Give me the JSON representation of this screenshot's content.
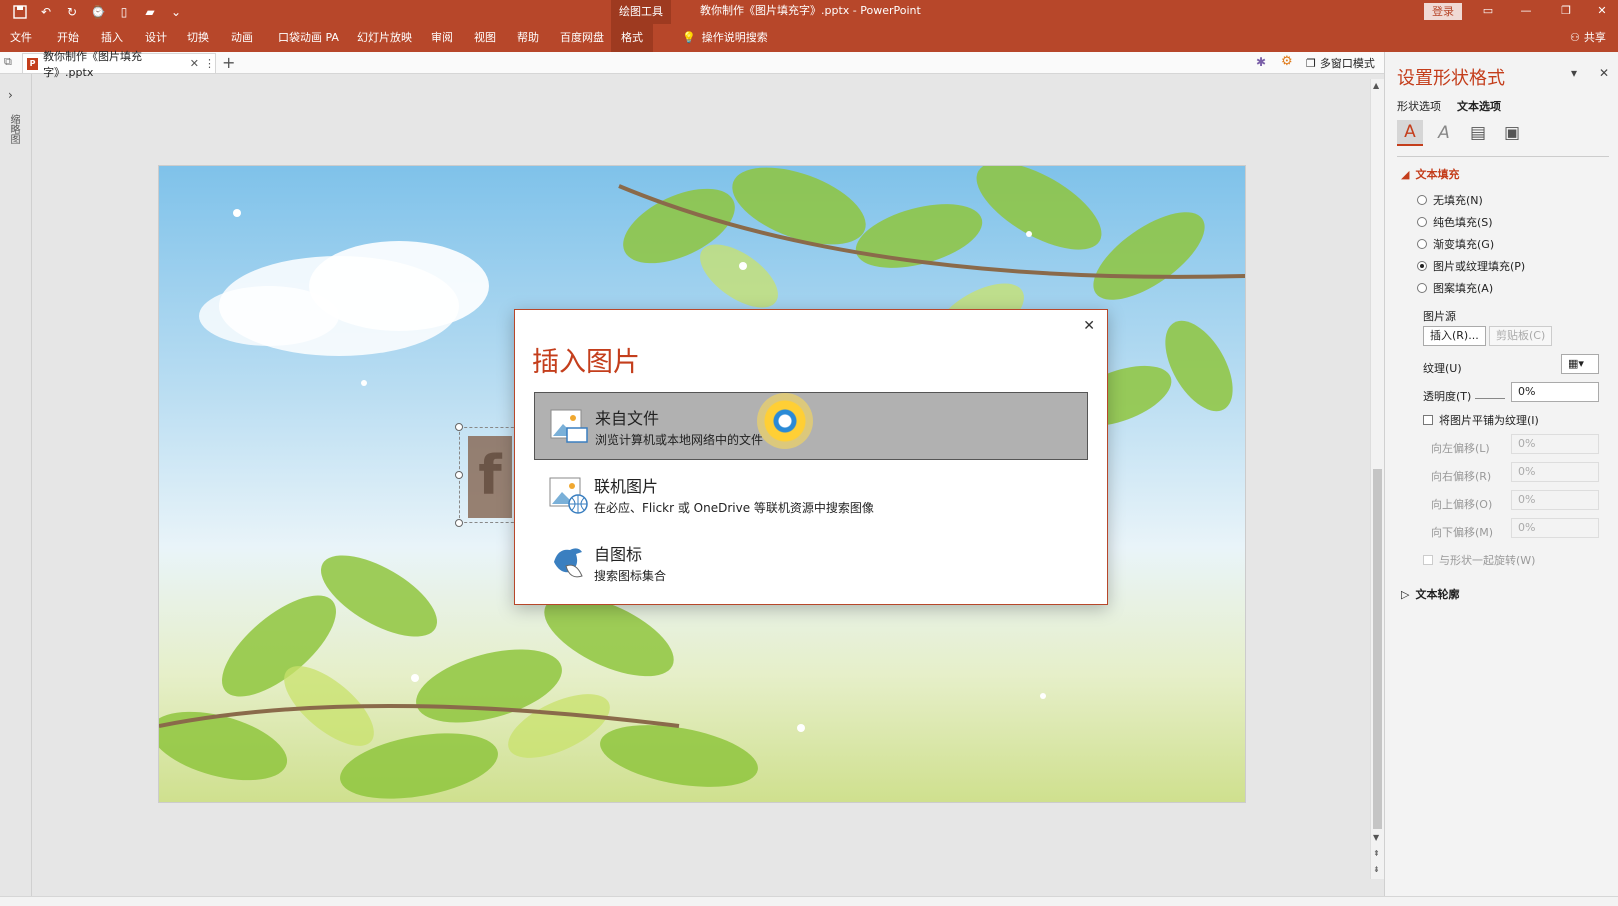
{
  "titlebar": {
    "context_tab": "绘图工具",
    "window_title": "教你制作《图片填充字》.pptx  -  PowerPoint",
    "login": "登录"
  },
  "menu": {
    "items": [
      "文件",
      "开始",
      "插入",
      "设计",
      "切换",
      "动画",
      "口袋动画 PA",
      "幻灯片放映",
      "审阅",
      "视图",
      "帮助",
      "百度网盘",
      "格式"
    ],
    "tell_me": "操作说明搜索",
    "share": "共享"
  },
  "doc_tab": {
    "label": "教你制作《图片填充字》.pptx",
    "multi_window": "多窗口模式"
  },
  "left_strip": {
    "label": "缩略图"
  },
  "slide": {
    "text_glyph": "f"
  },
  "dialog": {
    "title": "插入图片",
    "options": [
      {
        "title": "来自文件",
        "desc": "浏览计算机或本地网络中的文件"
      },
      {
        "title": "联机图片",
        "desc": "在必应、Flickr 或 OneDrive 等联机资源中搜索图像"
      },
      {
        "title": "自图标",
        "desc": "搜索图标集合"
      }
    ]
  },
  "pane": {
    "title": "设置形状格式",
    "tabs": [
      "形状选项",
      "文本选项"
    ],
    "section_fill": "文本填充",
    "fill_options": [
      "无填充(N)",
      "纯色填充(S)",
      "渐变填充(G)",
      "图片或纹理填充(P)",
      "图案填充(A)"
    ],
    "picture_source": "图片源",
    "insert_btn": "插入(R)...",
    "clipboard_btn": "剪贴板(C)",
    "texture_label": "纹理(U)",
    "transparency_label": "透明度(T)",
    "transparency_value": "0%",
    "tile_checkbox": "将图片平铺为纹理(I)",
    "offsets": [
      {
        "label": "向左偏移(L)",
        "value": "0%"
      },
      {
        "label": "向右偏移(R)",
        "value": "0%"
      },
      {
        "label": "向上偏移(O)",
        "value": "0%"
      },
      {
        "label": "向下偏移(M)",
        "value": "0%"
      }
    ],
    "rotate_checkbox": "与形状一起旋转(W)",
    "section_outline": "文本轮廓"
  },
  "colors": {
    "brand": "#b7472a",
    "accent": "#c43e1c"
  }
}
